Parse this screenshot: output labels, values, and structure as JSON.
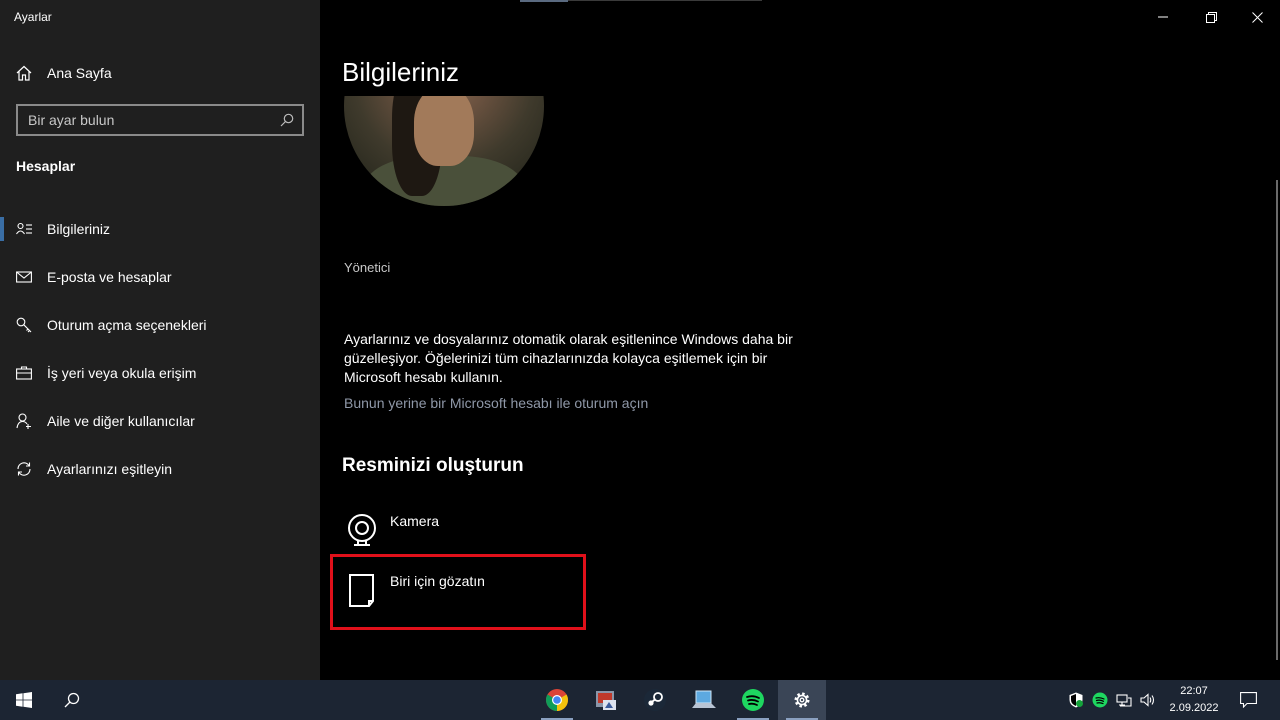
{
  "window": {
    "app_title": "Ayarlar",
    "controls": [
      "minimize",
      "restore",
      "close"
    ]
  },
  "sidebar": {
    "home_label": "Ana Sayfa",
    "search_placeholder": "Bir ayar bulun",
    "section_title": "Hesaplar",
    "items": [
      {
        "label": "Bilgileriniz",
        "icon": "person-info-icon",
        "active": true
      },
      {
        "label": "E-posta ve hesaplar",
        "icon": "mail-icon",
        "active": false
      },
      {
        "label": "Oturum açma seçenekleri",
        "icon": "key-icon",
        "active": false
      },
      {
        "label": "İş yeri veya okula erişim",
        "icon": "briefcase-icon",
        "active": false
      },
      {
        "label": "Aile ve diğer kullanıcılar",
        "icon": "person-add-icon",
        "active": false
      },
      {
        "label": "Ayarlarınızı eşitleyin",
        "icon": "sync-icon",
        "active": false
      }
    ]
  },
  "main": {
    "page_title": "Bilgileriniz",
    "role": "Yönetici",
    "info_text": "Ayarlarınız ve dosyalarınız otomatik olarak eşitlenince Windows daha bir güzelleşiyor. Öğelerinizi tüm cihazlarınızda kolayca eşitlemek için bir Microsoft hesabı kullanın.",
    "ms_link": "Bunun yerine bir Microsoft hesabı ile oturum açın",
    "create_title": "Resminizi oluşturun",
    "options": [
      {
        "label": "Kamera",
        "icon": "camera-icon"
      },
      {
        "label": "Biri için gözatın",
        "icon": "file-icon"
      }
    ],
    "highlight_color": "#e0101a"
  },
  "taskbar": {
    "apps": [
      "chrome-icon",
      "image-viewer-icon",
      "steam-icon",
      "laptop-icon",
      "spotify-icon",
      "settings-icon"
    ],
    "active_app": "settings-icon",
    "time": "22:07",
    "date": "2.09.2022"
  }
}
